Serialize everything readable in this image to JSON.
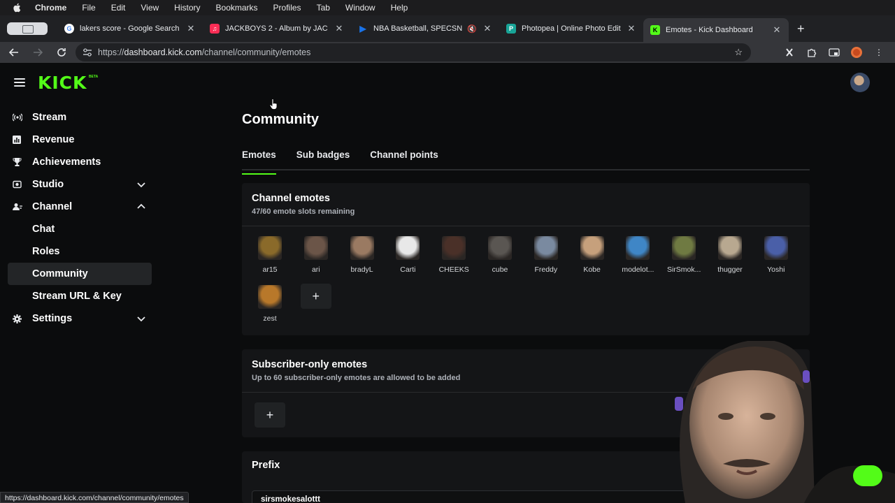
{
  "os_menu": {
    "app": "Chrome",
    "items": [
      "File",
      "Edit",
      "View",
      "History",
      "Bookmarks",
      "Profiles",
      "Tab",
      "Window",
      "Help"
    ]
  },
  "tabs": [
    {
      "title": "lakers score - Google Search",
      "favicon": "google-icon",
      "color": "#4285f4"
    },
    {
      "title": "JACKBOYS 2 - Album by JAC",
      "favicon": "apple-music-icon",
      "color": "#fa2d55"
    },
    {
      "title": "NBA Basketball, SPECSN,",
      "favicon": "play-icon",
      "color": "#1a73e8"
    },
    {
      "title": "Photopea | Online Photo Edito",
      "favicon": "photopea-icon",
      "color": "#18a497"
    },
    {
      "title": "Emotes - Kick Dashboard",
      "favicon": "kick-icon",
      "color": "#53fc18",
      "active": true
    }
  ],
  "address": {
    "scheme": "https://",
    "host": "dashboard.kick.com",
    "path": "/channel/community/emotes"
  },
  "kick": {
    "logo": "KICK",
    "beta": "BETA",
    "sidebar": {
      "stream": "Stream",
      "revenue": "Revenue",
      "achievements": "Achievements",
      "studio": "Studio",
      "channel": "Channel",
      "chat": "Chat",
      "roles": "Roles",
      "community": "Community",
      "stream_url": "Stream URL & Key",
      "settings": "Settings"
    },
    "page_title": "Community",
    "tabs": {
      "emotes": "Emotes",
      "sub_badges": "Sub badges",
      "channel_points": "Channel points"
    },
    "channel_emotes": {
      "title": "Channel emotes",
      "subtitle": "47/60 emote slots remaining",
      "emotes": [
        {
          "name": "ar15",
          "color": "#8a6a2a"
        },
        {
          "name": "ari",
          "color": "#6b5548"
        },
        {
          "name": "bradyL",
          "color": "#9a7a62"
        },
        {
          "name": "Carti",
          "color": "#e8e8e8"
        },
        {
          "name": "CHEEKS",
          "color": "#4a3028"
        },
        {
          "name": "cube",
          "color": "#5a5652"
        },
        {
          "name": "Freddy",
          "color": "#7a8aa0"
        },
        {
          "name": "Kobe",
          "color": "#c6a07c"
        },
        {
          "name": "modelot...",
          "color": "#3f86c6"
        },
        {
          "name": "SirSmok...",
          "color": "#6f7a42"
        },
        {
          "name": "thugger",
          "color": "#b8a890"
        },
        {
          "name": "Yoshi",
          "color": "#4a5fa8"
        },
        {
          "name": "zest",
          "color": "#b8782a"
        }
      ]
    },
    "subscriber_emotes": {
      "title": "Subscriber-only emotes",
      "subtitle": "Up to 60 subscriber-only emotes are allowed to be added"
    },
    "prefix": {
      "title": "Prefix",
      "value": "sirsmokesalottt"
    }
  },
  "status_url": "https://dashboard.kick.com/channel/community/emotes"
}
